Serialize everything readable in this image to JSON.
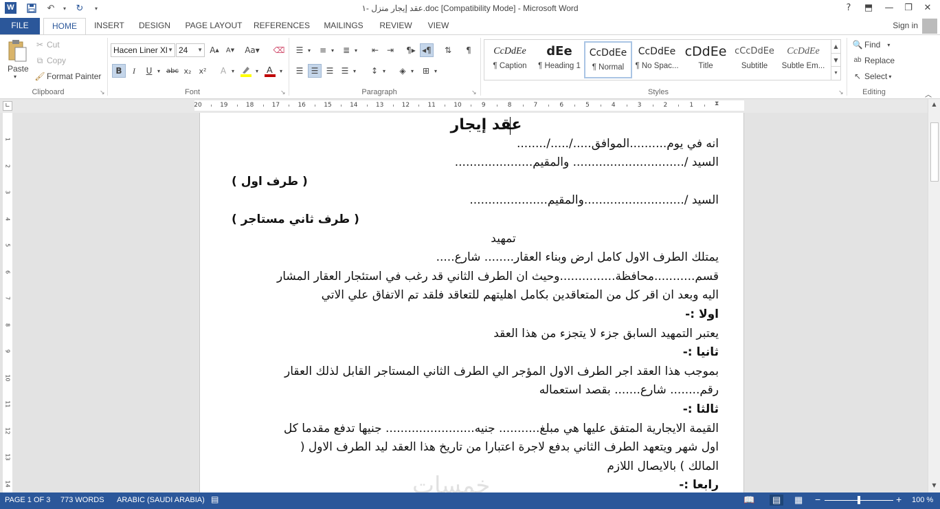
{
  "title_bar": {
    "title": "عقد إيجار منزل -١.doc [Compatibility Mode] - Microsoft Word",
    "app_icon": "W",
    "help": "?",
    "minimize": "—",
    "restore": "❐",
    "close": "✕"
  },
  "tabs": [
    "FILE",
    "HOME",
    "INSERT",
    "DESIGN",
    "PAGE LAYOUT",
    "REFERENCES",
    "MAILINGS",
    "REVIEW",
    "VIEW"
  ],
  "active_tab": "HOME",
  "signin": "Sign in",
  "clipboard": {
    "paste": "Paste",
    "cut": "Cut",
    "copy": "Copy",
    "format_painter": "Format Painter",
    "label": "Clipboard"
  },
  "font": {
    "name": "Hacen Liner XL",
    "name_display": "Hacen Liner Xl",
    "size": "24",
    "bold": "B",
    "italic": "I",
    "underline": "U",
    "strike": "abc",
    "subscript": "x₂",
    "superscript": "x²",
    "font_color": "#c00000",
    "highlight_color": "#ffff00",
    "label": "Font"
  },
  "paragraph": {
    "label": "Paragraph"
  },
  "styles": {
    "items": [
      {
        "preview": "CcDdEe",
        "name": "¶ Caption"
      },
      {
        "preview": "dEe",
        "name": "¶ Heading 1"
      },
      {
        "preview": "CcDdEe",
        "name": "¶ Normal"
      },
      {
        "preview": "CcDdEe",
        "name": "¶ No Spac..."
      },
      {
        "preview": "cDdEe",
        "name": "Title"
      },
      {
        "preview": "cCcDdEe",
        "name": "Subtitle"
      },
      {
        "preview": "CcDdEe",
        "name": "Subtle Em..."
      }
    ],
    "selected": "¶ Normal",
    "label": "Styles"
  },
  "editing": {
    "find": "Find",
    "replace": "Replace",
    "select": "Select",
    "label": "Editing"
  },
  "ruler_numbers": [
    "20",
    "19",
    "18",
    "17",
    "16",
    "15",
    "14",
    "13",
    "12",
    "11",
    "10",
    "9",
    "8",
    "7",
    "6",
    "5",
    "4",
    "3",
    "2",
    "1"
  ],
  "vruler_numbers": [
    "1",
    "2",
    "3",
    "4",
    "5",
    "6",
    "7",
    "8",
    "9",
    "10",
    "11",
    "12",
    "13",
    "14"
  ],
  "document": {
    "lines": [
      {
        "text": "عقد إيجار",
        "bold": true,
        "align": "center"
      },
      {
        "text": "انه في يوم..........الموافق...../...../........",
        "bold": false
      },
      {
        "text": "السيد /.............................. والمقيم.....................",
        "bold": false
      },
      {
        "text": "( طرف  اول )",
        "bold": true,
        "align": "left"
      },
      {
        "text": "السيد /...........................والمقيم.....................",
        "bold": false
      },
      {
        "text": "( طرف ثاني مستاجر )",
        "bold": true,
        "align": "left"
      },
      {
        "text": "تمهيد",
        "bold": false,
        "align": "center"
      },
      {
        "text": "يمتلك الطرف الاول كامل ارض وبناء العقار........ شارع.....",
        "bold": false
      },
      {
        "text": "قسم...........محافظة...............وحيث ان الطرف الثاني قد رغب في استئجار العقار المشار",
        "bold": false
      },
      {
        "text": "اليه وبعد ان اقر كل من المتعاقدين بكامل اهليتهم للتعاقد فلقد تم الاتفاق علي الاتي",
        "bold": false
      },
      {
        "text": "اولا :-",
        "bold": true
      },
      {
        "text": "يعتبر التمهيد السابق جزء لا يتجزء من هذا العقد",
        "bold": false
      },
      {
        "text": "ثانيا :-",
        "bold": true
      },
      {
        "text": "بموجب هذا العقد اجر الطرف الاول المؤجر الي الطرف الثاني المستاجر القابل لذلك العقار",
        "bold": false
      },
      {
        "text": "رقم........  شارع.......    بقصد استعماله",
        "bold": false
      },
      {
        "text": "ثالثا :-",
        "bold": true
      },
      {
        "text": "القيمة الايجارية المتفق عليها هي مبلغ........... جنيه........................ جنيها تدفع مقدما كل",
        "bold": false
      },
      {
        "text": "اول شهر ويتعهد الطرف الثاني بدفع لاجرة اعتبارا من تاريخ هذا العقد ليد الطرف الاول (",
        "bold": false
      },
      {
        "text": "المالك ) بالايصال اللازم",
        "bold": false
      },
      {
        "text": "رابعا :-",
        "bold": true
      }
    ]
  },
  "status_bar": {
    "page": "PAGE 1 OF 3",
    "words": "773 WORDS",
    "language": "ARABIC (SAUDI ARABIA)",
    "zoom": "100 %",
    "minus": "−",
    "plus": "+"
  },
  "watermark": "خمسات"
}
